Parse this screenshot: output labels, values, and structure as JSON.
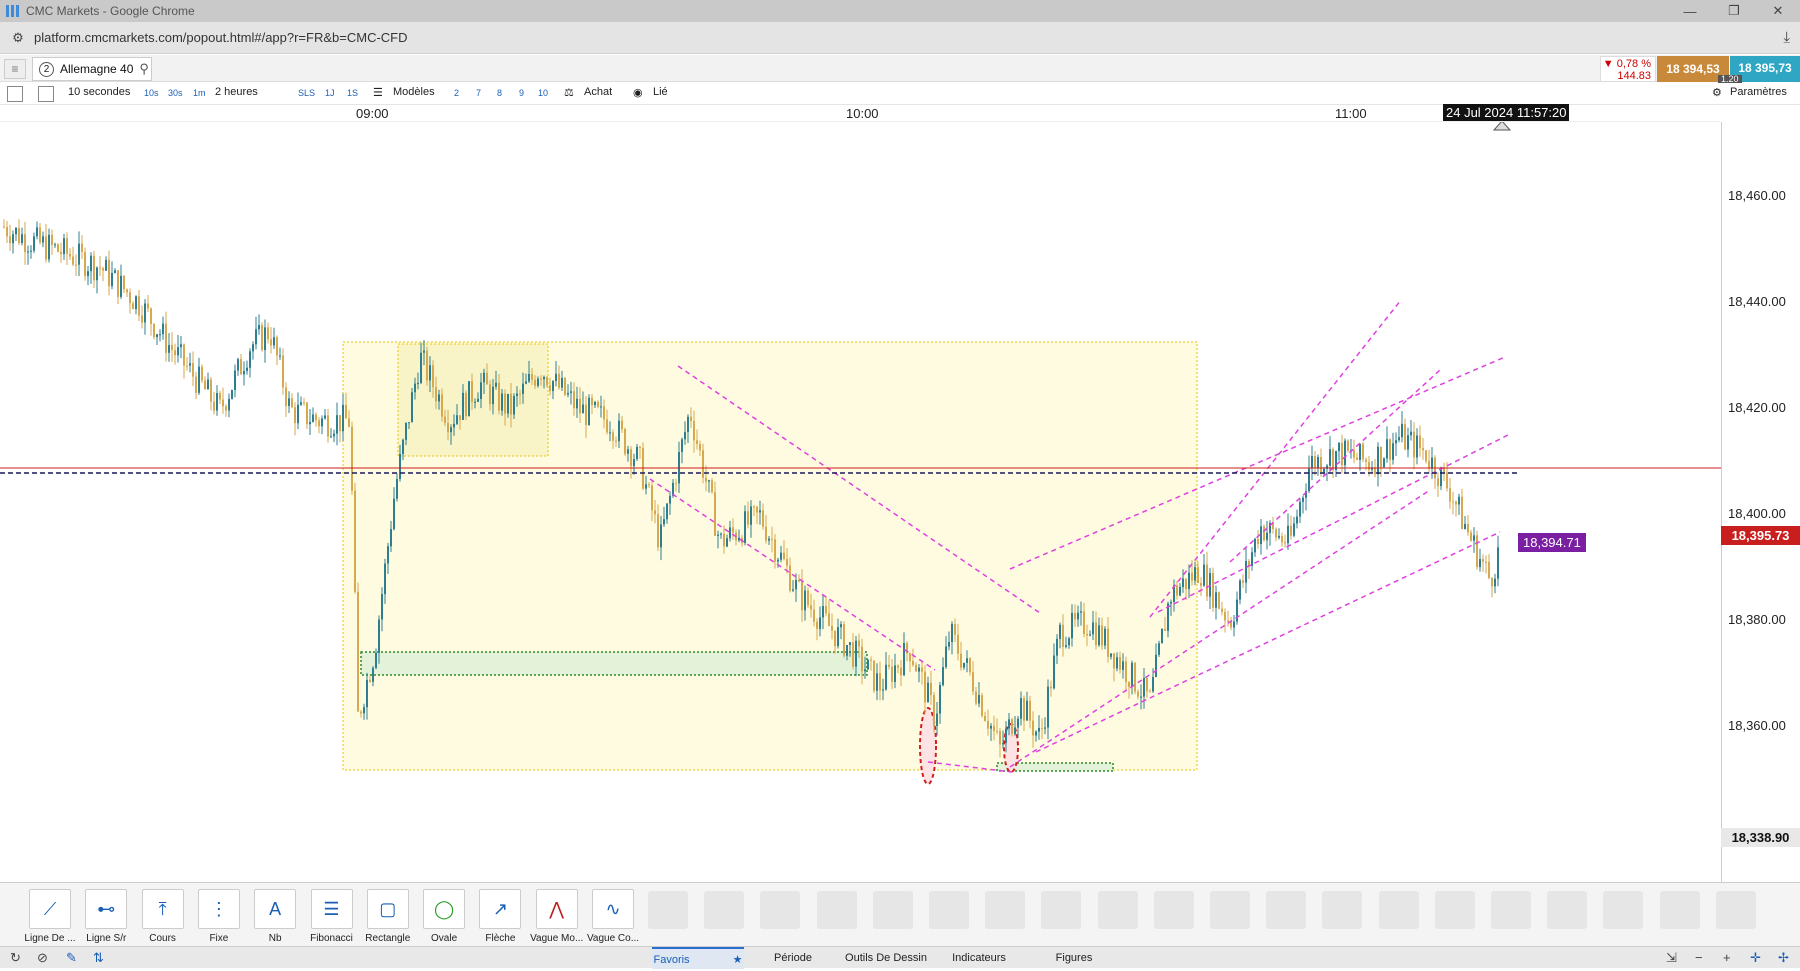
{
  "window": {
    "title": "CMC Markets - Google Chrome"
  },
  "browser": {
    "url": "platform.cmcmarkets.com/popout.html#/app?r=FR&b=CMC-CFD"
  },
  "instrument": {
    "tab_number": "2",
    "name": "Allemagne 40"
  },
  "quote": {
    "change_pct": "▼ 0,78 %",
    "change_pts": "144.83",
    "sell": "18 394,53",
    "buy": "18 395,73",
    "spread": "1.20"
  },
  "toolbar": {
    "interval": "10 secondes",
    "quick_intervals": [
      "10s",
      "30s",
      "1m"
    ],
    "range": "2 heures",
    "quick_ranges": [
      "SLS",
      "1J",
      "1S"
    ],
    "templates": "Modèles",
    "counts": [
      "2",
      "7",
      "8",
      "9",
      "10"
    ],
    "side": "Achat",
    "linked": "Lié",
    "settings": "Paramètres"
  },
  "time_axis": {
    "ticks": [
      "09:00",
      "10:00",
      "11:00"
    ],
    "cursor_label": "24 Jul 2024 11:57:20"
  },
  "price_axis": {
    "labels": [
      "18,460.00",
      "18,440.00",
      "18,420.00",
      "18,400.00",
      "18,380.00",
      "18,360.00"
    ],
    "low_label": "18,338.90",
    "current_price": "18,395.73",
    "line_label": "18,394.71"
  },
  "colors": {
    "current": "#c81e1e",
    "line_tag": "#7b1fa2",
    "trend": "#e040e0",
    "up": "#2d7f8f",
    "down": "#d6a84f"
  },
  "drawing_tools": [
    {
      "label": "Ligne De ...",
      "icon": "line-icon"
    },
    {
      "label": "Ligne S/r",
      "icon": "sr-line-icon"
    },
    {
      "label": "Cours",
      "icon": "price-line-icon"
    },
    {
      "label": "Fixe",
      "icon": "fixed-line-icon"
    },
    {
      "label": "Nb",
      "icon": "text-icon"
    },
    {
      "label": "Fibonacci",
      "icon": "fibonacci-icon"
    },
    {
      "label": "Rectangle",
      "icon": "rectangle-icon"
    },
    {
      "label": "Ovale",
      "icon": "oval-icon"
    },
    {
      "label": "Flèche",
      "icon": "arrow-icon"
    },
    {
      "label": "Vague Mo...",
      "icon": "wave-icon"
    },
    {
      "label": "Vague Co...",
      "icon": "wave-corrective-icon"
    }
  ],
  "bottom_tabs": [
    "Favoris",
    "Période",
    "Outils De Dessin",
    "Indicateurs",
    "Figures"
  ]
}
